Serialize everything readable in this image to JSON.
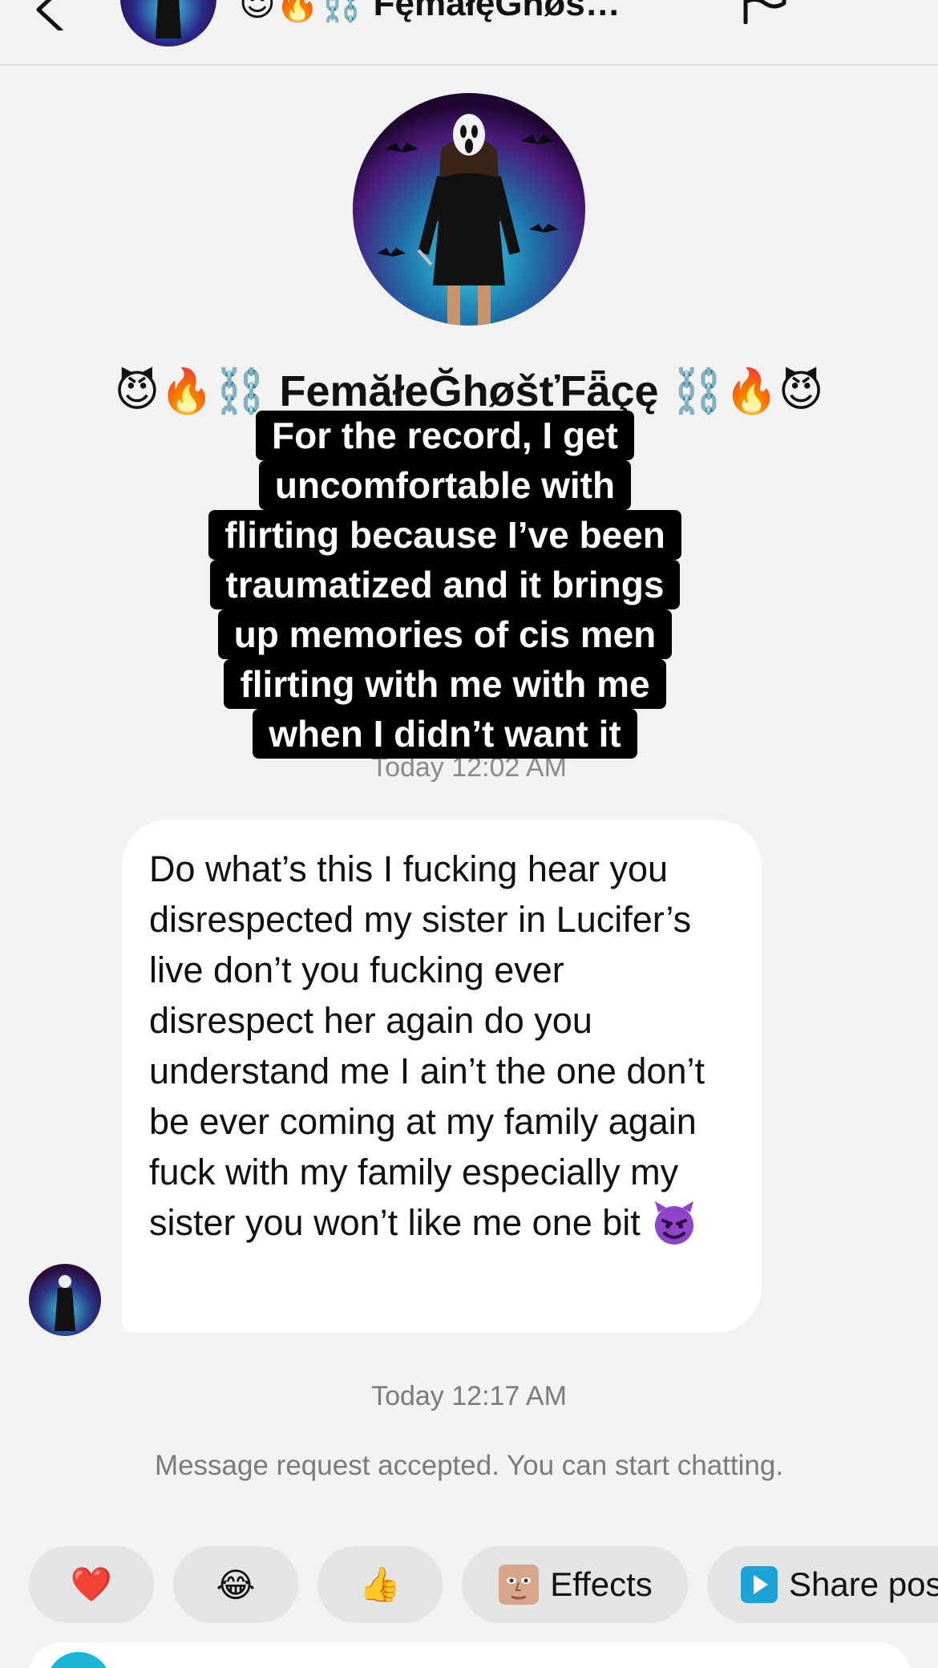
{
  "header": {
    "title": "😈🔥⛓️ FęmałęGħøs…"
  },
  "profile": {
    "name": "😈🔥⛓️ FemăłeĞhøšťFǟçę ⛓️🔥😈"
  },
  "caption": {
    "lines": [
      "For the record, I get",
      "uncomfortable with",
      "flirting because I’ve been",
      "traumatized and it brings",
      "up memories of cis men",
      "flirting with me with me",
      "when I didn’t want it"
    ]
  },
  "faded_time": "Today 12:02 AM",
  "message": {
    "text": "Do what’s this I fucking hear you disrespected my sister in Lucifer’s live don’t you fucking ever disrespect her again do you understand me I ain’t the one don’t be ever coming at my family again fuck with my family especially my sister you won’t like me one bit"
  },
  "timestamp": "Today 12:17 AM",
  "request_note": "Message request accepted. You can start chatting.",
  "quick_reactions": {
    "heart": "❤️",
    "laugh": "😂",
    "thumbs": "👍",
    "effects_label": "Effects",
    "share_label": "Share pos"
  },
  "colors": {
    "background": "#f2f2f2",
    "bubble": "#ffffff",
    "chip": "#e4e4e4",
    "caption_bg": "#000000",
    "accent": "#1bb5d6"
  }
}
